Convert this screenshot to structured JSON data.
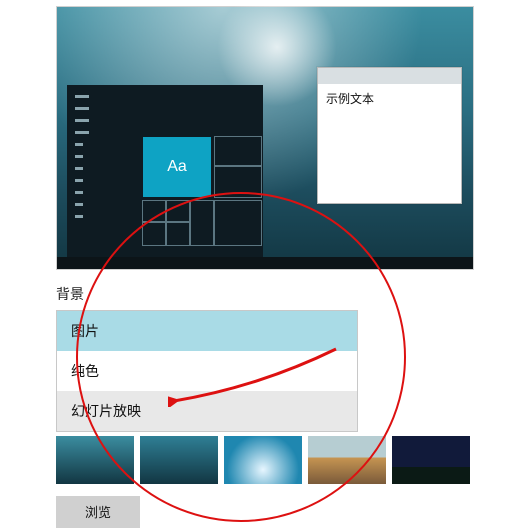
{
  "preview": {
    "tile_label": "Aa",
    "note_text": "示例文本"
  },
  "background_section": {
    "label": "背景",
    "options": [
      "图片",
      "纯色",
      "幻灯片放映"
    ],
    "selected_index": 0,
    "arrow_target_index": 2
  },
  "browse_button": "浏览",
  "thumbnails": [
    "wallpaper-1",
    "wallpaper-2",
    "wallpaper-3",
    "wallpaper-4",
    "wallpaper-5"
  ],
  "annotation": {
    "circle_color": "#dd1111",
    "arrow_color": "#dd1111"
  }
}
